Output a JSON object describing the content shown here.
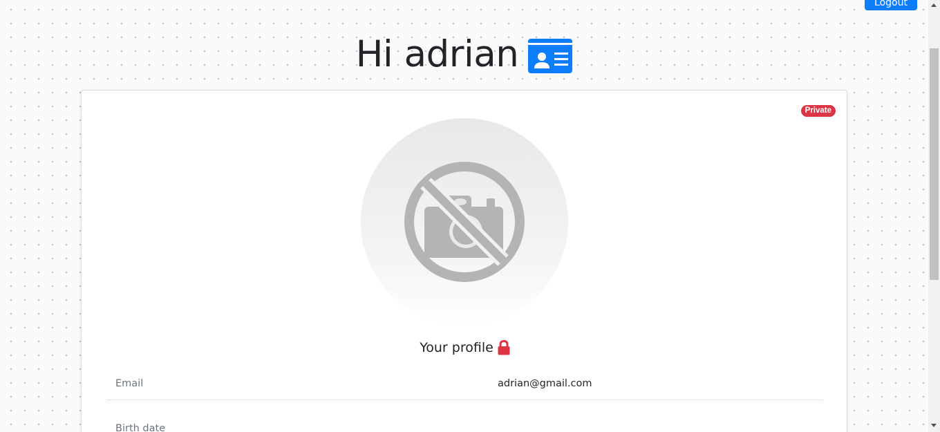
{
  "header": {
    "logout_label": "Logout",
    "greeting": "Hi adrian",
    "greeting_icon": "id-card-icon"
  },
  "profile": {
    "visibility_badge": "Private",
    "avatar_icon": "no-photo-icon",
    "heading": "Your profile",
    "heading_icon": "lock-icon",
    "fields": [
      {
        "label": "Email",
        "value": "adrian@gmail.com"
      },
      {
        "label": "Birth date",
        "value": ""
      }
    ]
  },
  "colors": {
    "primary": "#0d7dfb",
    "danger": "#dc3545",
    "icon_gray": "#b4b4b4"
  }
}
